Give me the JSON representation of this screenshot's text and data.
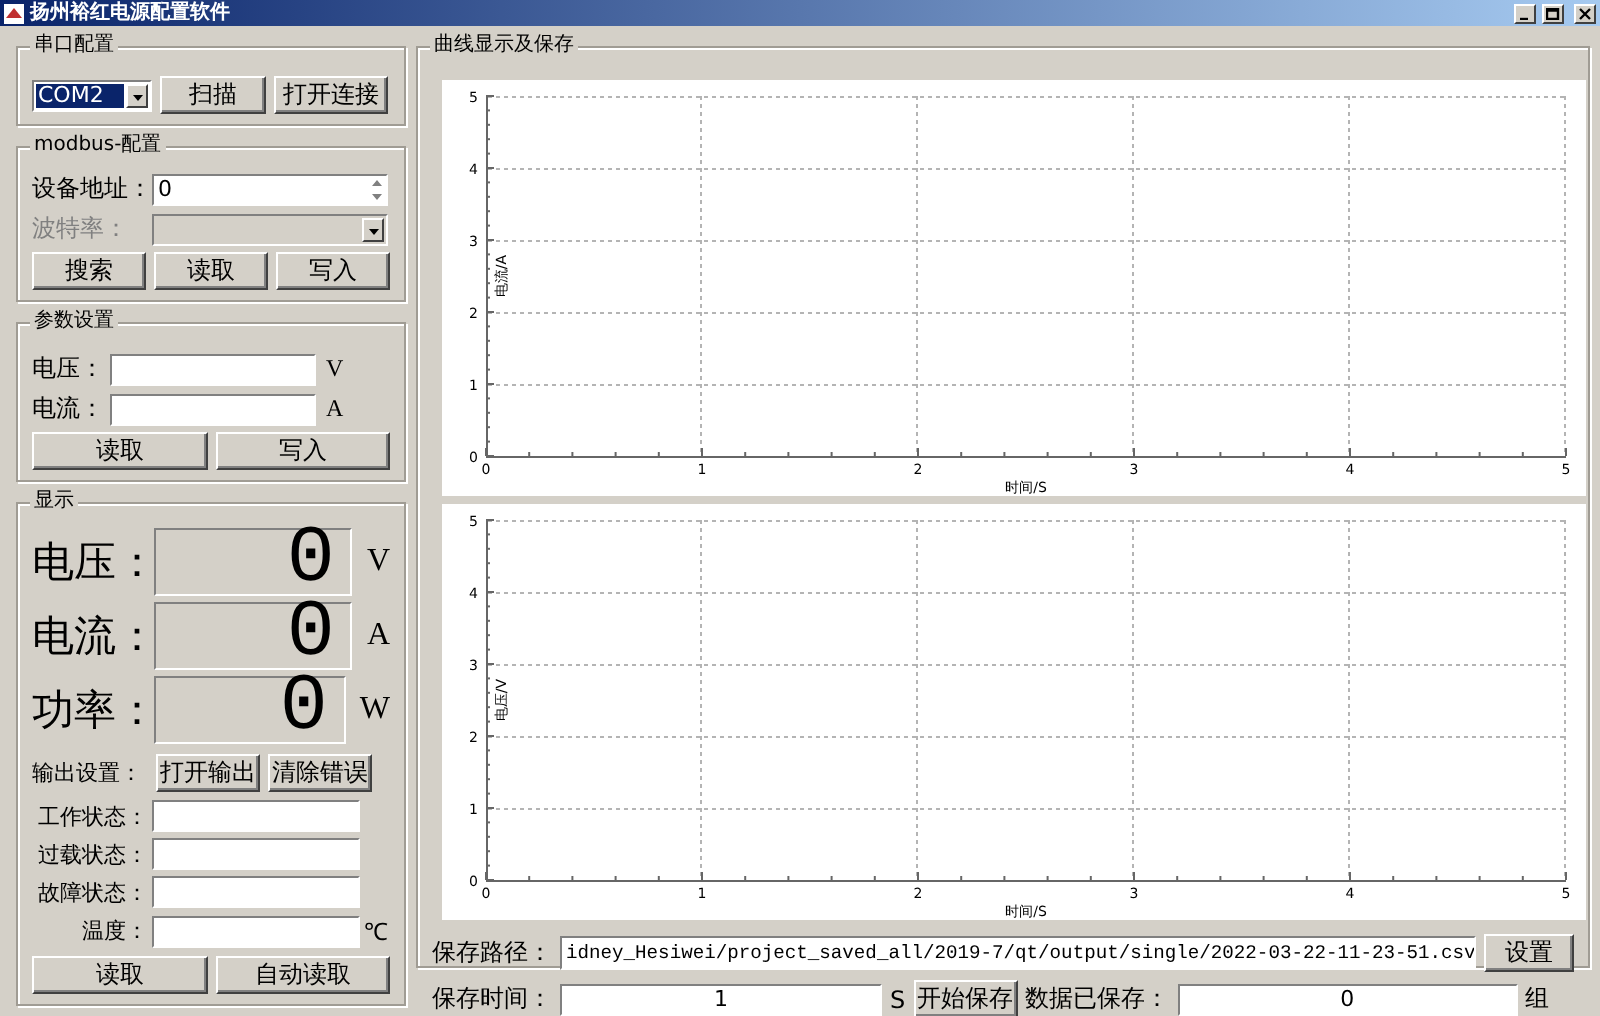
{
  "window": {
    "title": "扬州裕红电源配置软件"
  },
  "serial_config": {
    "title": "串口配置",
    "port": "COM2",
    "buttons": [
      "扫描",
      "打开连接"
    ]
  },
  "modbus_config": {
    "title": "modbus-配置",
    "address": {
      "label": "设备地址：",
      "value": "0"
    },
    "baud_rate": {
      "label": "波特率：",
      "disabled": true
    },
    "buttons": [
      "搜索",
      "读取",
      "写入"
    ]
  },
  "param_settings": {
    "title": "参数设置",
    "fields": [
      {
        "label": "电压：",
        "unit": "V"
      },
      {
        "label": "电流：",
        "unit": "A"
      }
    ],
    "buttons": [
      "读取",
      "写入"
    ]
  },
  "display": {
    "title": "显示",
    "readings": [
      {
        "label": "电压：",
        "value": "0",
        "unit": "V"
      },
      {
        "label": "电流：",
        "value": "0",
        "unit": "A"
      },
      {
        "label": "功率：",
        "value": "0",
        "unit": "W"
      }
    ],
    "output": {
      "label": "输出设置：",
      "buttons": [
        "打开输出",
        "清除错误"
      ]
    },
    "status_fields": [
      {
        "label": "工作状态："
      },
      {
        "label": "过载状态："
      },
      {
        "label": "故障状态："
      },
      {
        "label": "温度：",
        "unit": "℃"
      }
    ],
    "buttons": [
      "读取",
      "自动读取"
    ]
  },
  "curves": {
    "title": "曲线显示及保存",
    "charts": [
      {
        "chart_data": {
          "type": "line",
          "grid": true,
          "xlabel": "时间/S",
          "ylabel": "电流/A",
          "xlim": [
            0,
            5
          ],
          "ylim": [
            0,
            5
          ],
          "xticks": [
            0,
            1,
            2,
            3,
            4,
            5
          ],
          "yticks": [
            0,
            1,
            2,
            3,
            4,
            5
          ]
        }
      },
      {
        "chart_data": {
          "type": "line",
          "grid": true,
          "xlabel": "时间/S",
          "ylabel": "电压/V",
          "xlim": [
            0,
            5
          ],
          "ylim": [
            0,
            5
          ],
          "xticks": [
            0,
            1,
            2,
            3,
            4,
            5
          ],
          "yticks": [
            0,
            1,
            2,
            3,
            4,
            5
          ]
        }
      }
    ],
    "save_path": {
      "label": "保存路径：",
      "value": "idney_Hesiwei/project_saved_all/2019-7/qt/output/single/2022-03-22-11-23-51.csv",
      "button": "设置"
    },
    "save_time": {
      "label": "保存时间：",
      "value": "1",
      "unit": "S"
    },
    "start_button": "开始保存",
    "saved_count": {
      "label": "数据已保存：",
      "value": "0",
      "unit": "组"
    }
  }
}
